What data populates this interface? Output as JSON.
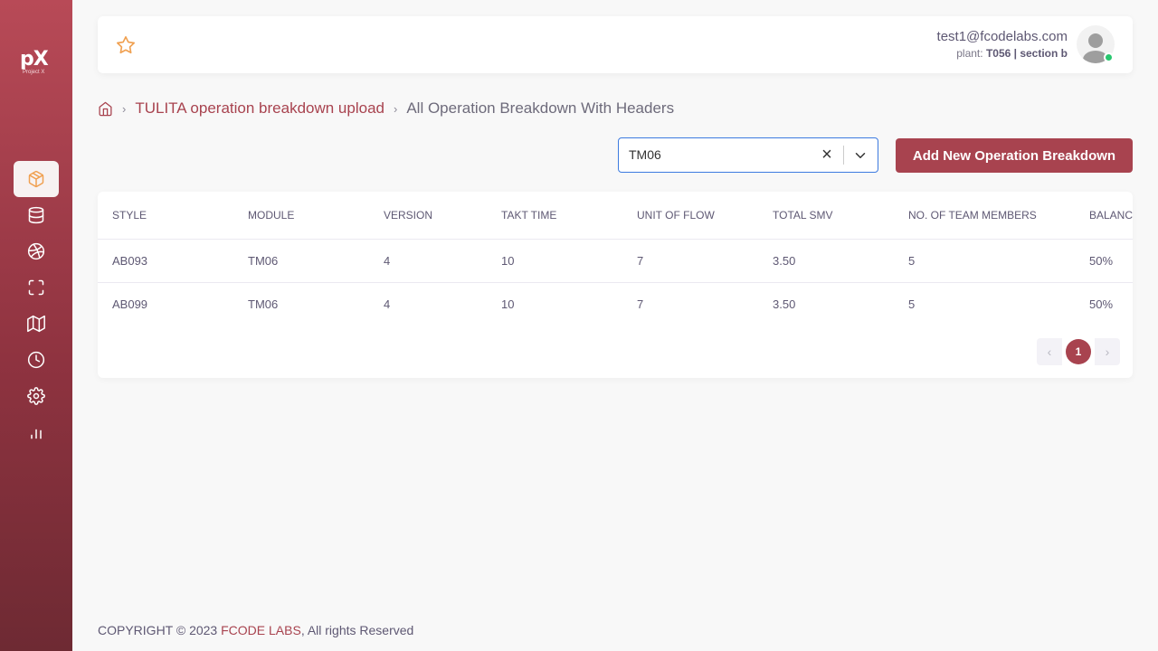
{
  "app": {
    "logo_main": "pX",
    "logo_sub": "Project X"
  },
  "sidebar": {
    "items": [
      {
        "icon": "box-icon",
        "active": true
      },
      {
        "icon": "database-icon",
        "active": false
      },
      {
        "icon": "dribbble-icon",
        "active": false
      },
      {
        "icon": "maximize-icon",
        "active": false
      },
      {
        "icon": "map-icon",
        "active": false
      },
      {
        "icon": "clock-icon",
        "active": false
      },
      {
        "icon": "settings-icon",
        "active": false
      },
      {
        "icon": "bar-chart-icon",
        "active": false
      }
    ]
  },
  "header": {
    "email": "test1@fcodelabs.com",
    "plant_label": "plant:",
    "plant_value": "T056 | section b"
  },
  "breadcrumb": {
    "parent": "TULITA operation breakdown upload",
    "current": "All Operation Breakdown With Headers"
  },
  "filter": {
    "selected": "TM06",
    "clear_label": "×"
  },
  "actions": {
    "add_label": "Add New Operation Breakdown"
  },
  "table": {
    "columns": [
      "STYLE",
      "MODULE",
      "VERSION",
      "TAKT TIME",
      "UNIT OF FLOW",
      "TOTAL SMV",
      "NO. OF TEAM MEMBERS",
      "BALANCE"
    ],
    "rows": [
      [
        "AB093",
        "TM06",
        "4",
        "10",
        "7",
        "3.50",
        "5",
        "50%"
      ],
      [
        "AB099",
        "TM06",
        "4",
        "10",
        "7",
        "3.50",
        "5",
        "50%"
      ]
    ]
  },
  "pagination": {
    "prev": "‹",
    "current": "1",
    "next": "›"
  },
  "footer": {
    "prefix": "COPYRIGHT © 2023 ",
    "brand": "FCODE LABS",
    "suffix": ", All rights Reserved"
  },
  "colors": {
    "primary": "#a8434f",
    "accent": "#f0a050",
    "online": "#28c76f",
    "focus": "#3d7be0"
  }
}
